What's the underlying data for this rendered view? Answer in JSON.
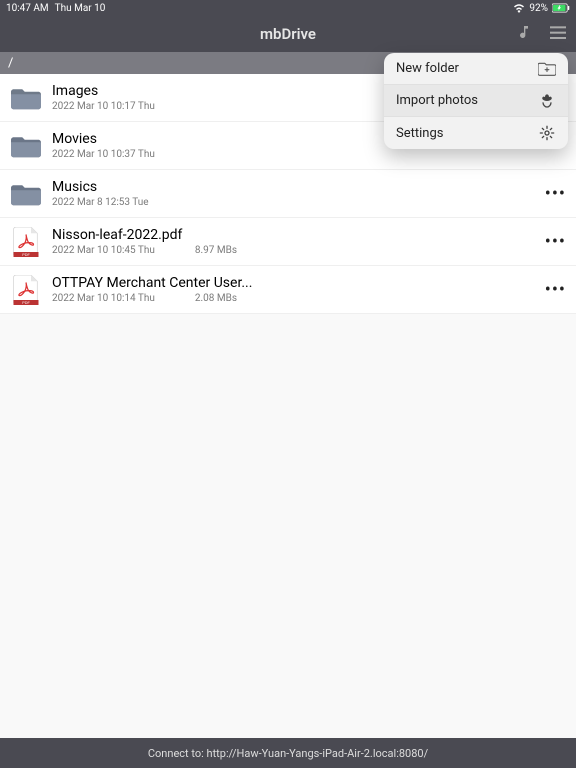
{
  "statusbar": {
    "time": "10:47 AM",
    "date": "Thu Mar 10",
    "battery_pct": "92%"
  },
  "navbar": {
    "title": "mbDrive"
  },
  "path_bar": {
    "path": "/"
  },
  "popover": {
    "items": [
      {
        "label": "New folder",
        "icon": "new-folder-icon"
      },
      {
        "label": "Import photos",
        "icon": "import-photos-icon"
      },
      {
        "label": "Settings",
        "icon": "gear-icon"
      }
    ],
    "highlighted_index": 1
  },
  "files": [
    {
      "name": "Images",
      "type": "folder",
      "meta": "2022 Mar 10  10:17 Thu",
      "size": ""
    },
    {
      "name": "Movies",
      "type": "folder",
      "meta": "2022 Mar 10  10:37 Thu",
      "size": ""
    },
    {
      "name": "Musics",
      "type": "folder",
      "meta": "2022 Mar 8  12:53 Tue",
      "size": ""
    },
    {
      "name": "Nisson-leaf-2022.pdf",
      "type": "pdf",
      "meta": "2022 Mar 10  10:45 Thu",
      "size": "8.97 MBs"
    },
    {
      "name": "OTTPAY Merchant Center User...",
      "type": "pdf",
      "meta": "2022 Mar 10  10:14 Thu",
      "size": "2.08 MBs"
    }
  ],
  "footer": {
    "text": "Connect to: http://Haw-Yuan-Yangs-iPad-Air-2.local:8080/"
  }
}
